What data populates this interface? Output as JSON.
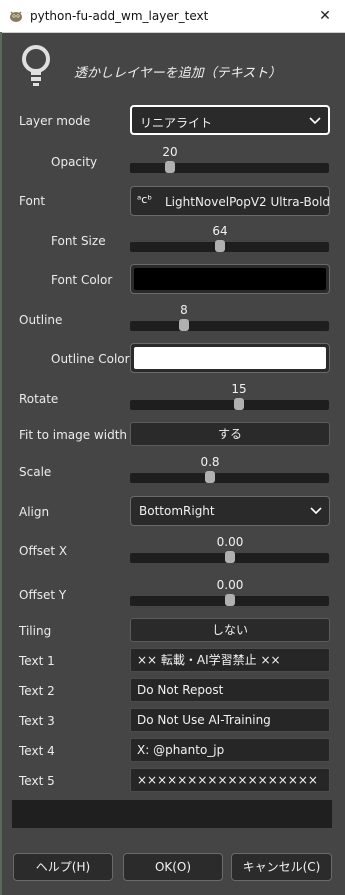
{
  "window": {
    "title": "python-fu-add_wm_layer_text",
    "close_glyph": "✕"
  },
  "header": {
    "title": "透かしレイヤーを追加（テキスト）"
  },
  "fields": {
    "layer_mode": {
      "label": "Layer mode",
      "value": "リニアライト"
    },
    "opacity": {
      "label": "Opacity",
      "value": "20",
      "level": 0.2
    },
    "font": {
      "label": "Font",
      "icon_text": "ᵃcᵇ",
      "value": "LightNovelPopV2 Ultra-Bold"
    },
    "font_size": {
      "label": "Font Size",
      "value": "64",
      "level": 0.45
    },
    "font_color": {
      "label": "Font Color",
      "color": "#000000"
    },
    "outline": {
      "label": "Outline",
      "value": "8",
      "level": 0.27
    },
    "outline_color": {
      "label": "Outline Color",
      "color": "#ffffff"
    },
    "rotate": {
      "label": "Rotate",
      "value": "15",
      "level": 0.55
    },
    "fit_width": {
      "label": "Fit to image width",
      "value": "する"
    },
    "scale": {
      "label": "Scale",
      "value": "0.8",
      "level": 0.4
    },
    "align": {
      "label": "Align",
      "value": "BottomRight"
    },
    "offset_x": {
      "label": "Offset X",
      "value": "0.00",
      "level": 0.5
    },
    "offset_y": {
      "label": "Offset Y",
      "value": "0.00",
      "level": 0.5
    },
    "tiling": {
      "label": "Tiling",
      "value": "しない"
    },
    "text1": {
      "label": "Text 1",
      "value": "×× 転載・AI学習禁止 ××"
    },
    "text2": {
      "label": "Text 2",
      "value": "Do Not Repost"
    },
    "text3": {
      "label": "Text 3",
      "value": "Do Not Use AI-Training"
    },
    "text4": {
      "label": "Text 4",
      "value": "X: @phanto_jp"
    },
    "text5": {
      "label": "Text 5",
      "value": "××××××××××××××××××"
    }
  },
  "buttons": {
    "help": "ヘルプ(H)",
    "ok": "OK(O)",
    "cancel": "キャンセル(C)"
  },
  "colors": {
    "background": "#454545",
    "field": "#2a2a2a",
    "titlebar": "#ffffff"
  }
}
